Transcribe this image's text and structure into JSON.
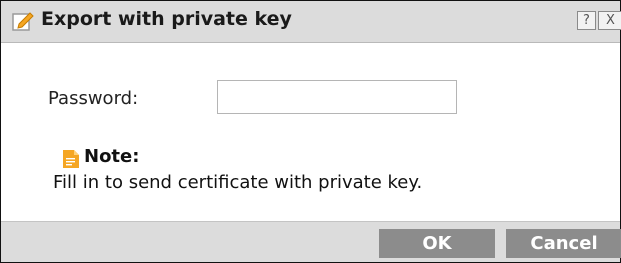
{
  "dialog": {
    "title": "Export with private key",
    "title_icon": "edit-icon",
    "help_glyph": "?",
    "close_glyph": "X"
  },
  "form": {
    "password_label": "Password:",
    "password_value": "",
    "password_placeholder": ""
  },
  "note": {
    "icon": "note-icon",
    "label": "Note:",
    "text": "Fill in to send certificate with private key."
  },
  "footer": {
    "ok_label": "OK",
    "cancel_label": "Cancel"
  },
  "colors": {
    "titlebar_bg": "#dcdcdc",
    "button_bg": "#8c8c8c",
    "icon_accent": "#f5a623"
  }
}
